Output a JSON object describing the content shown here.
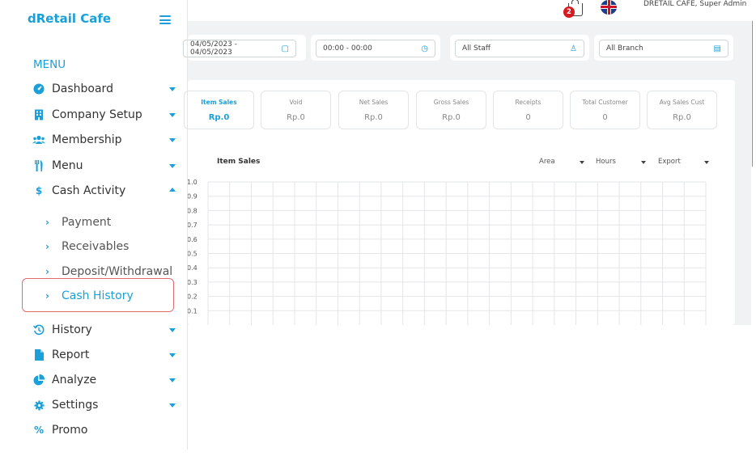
{
  "app": {
    "brand": "dRetail Cafe"
  },
  "sidebar": {
    "menu_title": "MENU",
    "items": [
      {
        "label": "Dashboard",
        "icon": "dashboard-icon"
      },
      {
        "label": "Company Setup",
        "icon": "building-icon"
      },
      {
        "label": "Membership",
        "icon": "users-icon"
      },
      {
        "label": "Menu",
        "icon": "utensils-icon"
      },
      {
        "label": "Cash Activity",
        "icon": "dollar-icon"
      },
      {
        "label": "History",
        "icon": "history-icon"
      },
      {
        "label": "Report",
        "icon": "file-icon"
      },
      {
        "label": "Analyze",
        "icon": "pie-chart-icon"
      },
      {
        "label": "Settings",
        "icon": "gear-icon"
      },
      {
        "label": "Promo",
        "icon": "percent-icon"
      }
    ],
    "cash_sub_items": [
      {
        "label": "Payment"
      },
      {
        "label": "Receivables"
      },
      {
        "label": "Deposit/Withdrawal"
      },
      {
        "label": "Cash History"
      }
    ],
    "selected": "Cash History"
  },
  "header": {
    "notification_count": "2",
    "user": "DRETAIL CAFE, Super Admin"
  },
  "filters": {
    "date_range": "04/05/2023 - 04/05/2023",
    "time_range": "00:00 - 00:00",
    "staff": "All Staff",
    "branch": "All Branch"
  },
  "stats": [
    {
      "title": "Item Sales",
      "value": "Rp.0"
    },
    {
      "title": "Void",
      "value": "Rp.0"
    },
    {
      "title": "Net Sales",
      "value": "Rp.0"
    },
    {
      "title": "Gross Sales",
      "value": "Rp.0"
    },
    {
      "title": "Receipts",
      "value": "0"
    },
    {
      "title": "Total Customer",
      "value": "0"
    },
    {
      "title": "Avg Sales Cust",
      "value": "Rp.0"
    }
  ],
  "chart": {
    "title": "Item Sales",
    "dropdowns": {
      "area": "Area",
      "hours": "Hours",
      "export": "Export"
    },
    "y_ticks": [
      "1.0",
      "0.9",
      "0.8",
      "0.7",
      "0.6",
      "0.5",
      "0.4",
      "0.3",
      "0.2",
      "0.1"
    ]
  },
  "colors": {
    "accent": "#1a9fd8",
    "highlight_border": "#e06b6b",
    "badge": "#d71920"
  }
}
